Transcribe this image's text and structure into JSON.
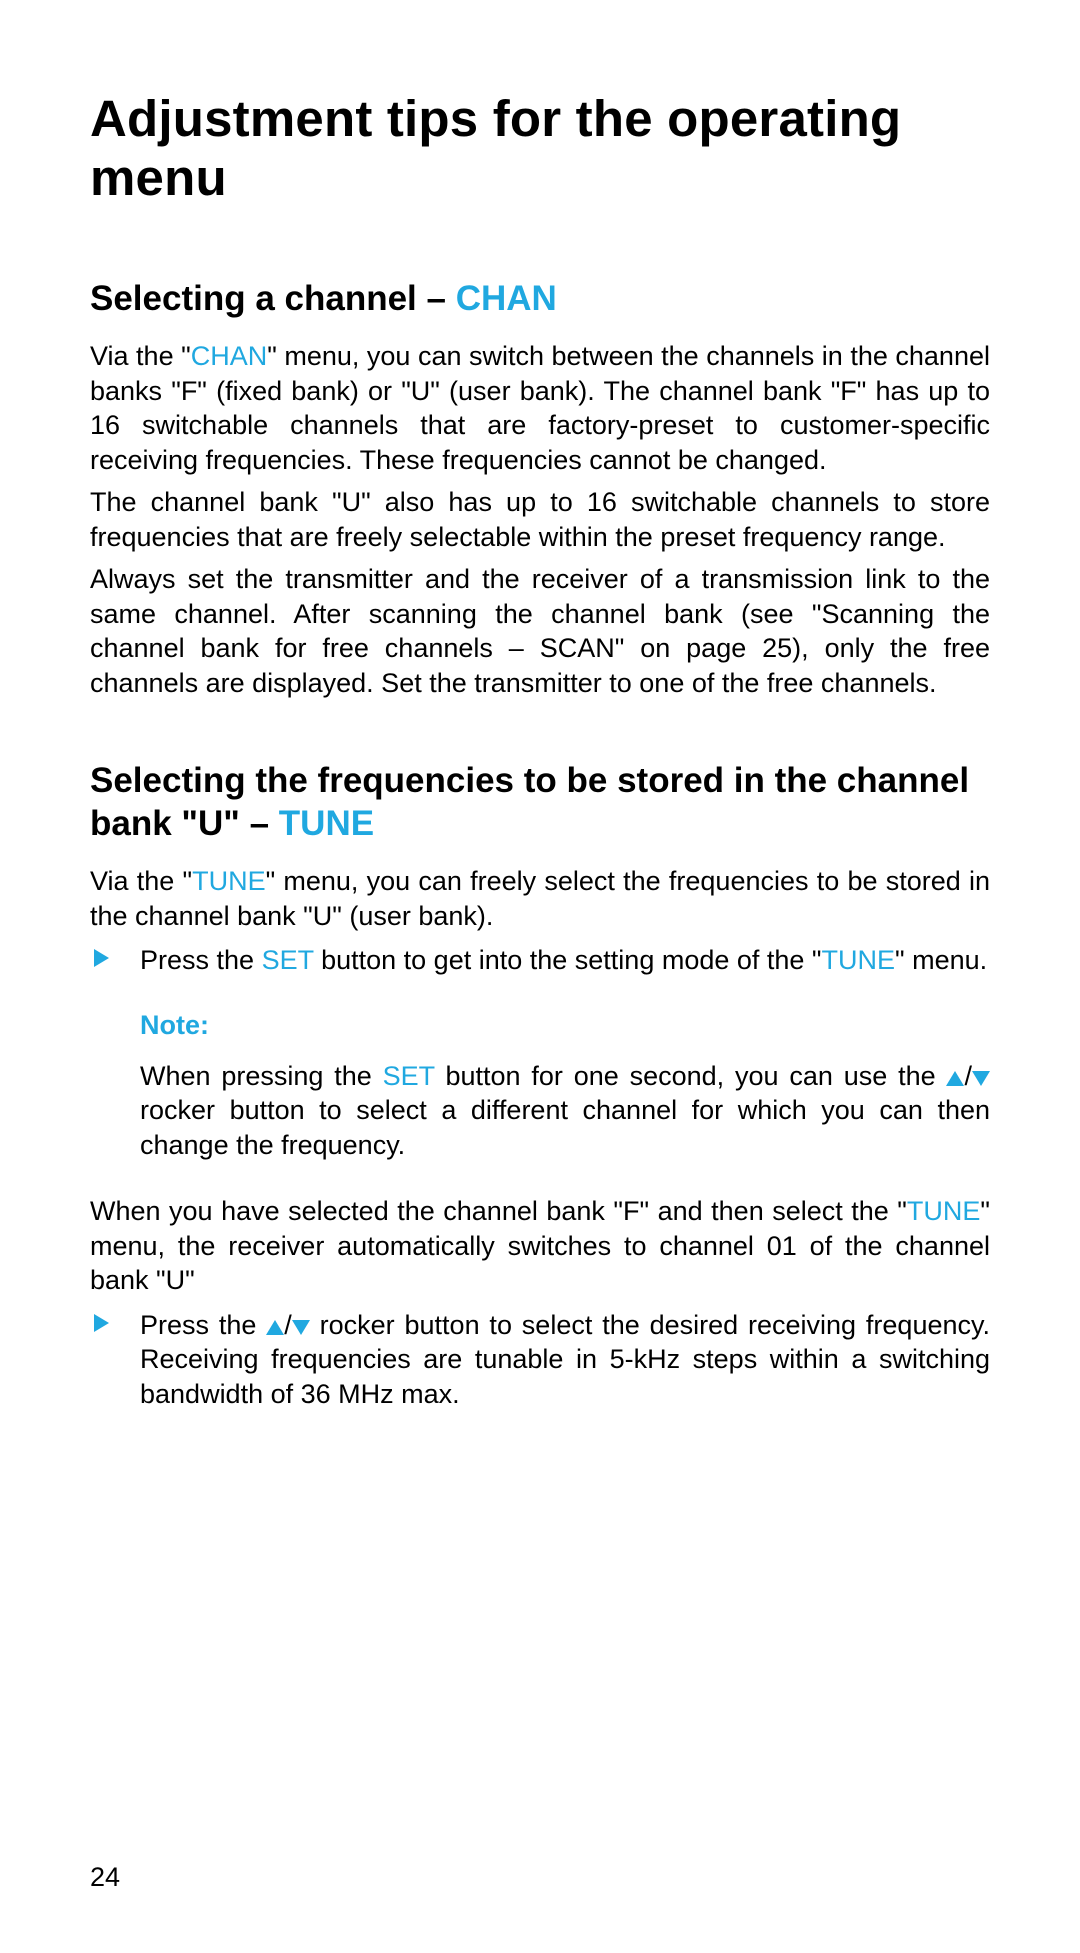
{
  "page_number": "24",
  "title": "Adjustment tips for the operating menu",
  "section1": {
    "heading_plain": "Selecting a channel – ",
    "heading_accent": "CHAN",
    "p1_a": "Via the \"",
    "p1_chan": "CHAN",
    "p1_b": "\" menu, you can switch between the channels in the channel banks \"F\" (fixed bank) or \"U\" (user bank). The channel bank \"F\" has up to 16 switchable channels that are factory-preset to customer-specific receiving frequencies. These frequencies cannot be changed.",
    "p2": "The channel bank \"U\" also has up to 16 switchable channels to store frequencies that are freely selectable within the preset frequency range.",
    "p3": "Always set the transmitter and the receiver of a transmission link to the same channel. After scanning the channel bank (see \"Scanning the channel bank for free channels – SCAN\" on page 25), only the free channels are displayed. Set the transmitter to one of the free channels."
  },
  "section2": {
    "heading_plain": "Selecting the frequencies to be stored in the channel bank \"U\" – ",
    "heading_accent": "TUNE",
    "p1_a": "Via the \"",
    "p1_tune": "TUNE",
    "p1_b": "\" menu, you can freely select the frequencies to be stored in the channel bank \"U\" (user bank).",
    "step1_a": "Press the ",
    "step1_set": "SET",
    "step1_b": " button to get into the setting mode of the \"",
    "step1_tune": "TUNE",
    "step1_c": "\" menu.",
    "note_label": "Note:",
    "note_a": "When pressing the ",
    "note_set": "SET",
    "note_b": " button for one second, you can use the ",
    "note_slash": "/",
    "note_c": " rocker button to select a different channel for which you can then change the frequency.",
    "p2_a": "When you have selected the channel bank \"F\" and then select the \"",
    "p2_tune": "TUNE",
    "p2_b": "\" menu, the receiver automatically switches to channel 01 of the channel bank \"U\"",
    "step2_a": "Press the ",
    "step2_slash": "/",
    "step2_b": " rocker button to select the desired receiving frequency. Receiving frequencies are tunable in 5-kHz steps within a switching bandwidth of 36 MHz max."
  }
}
